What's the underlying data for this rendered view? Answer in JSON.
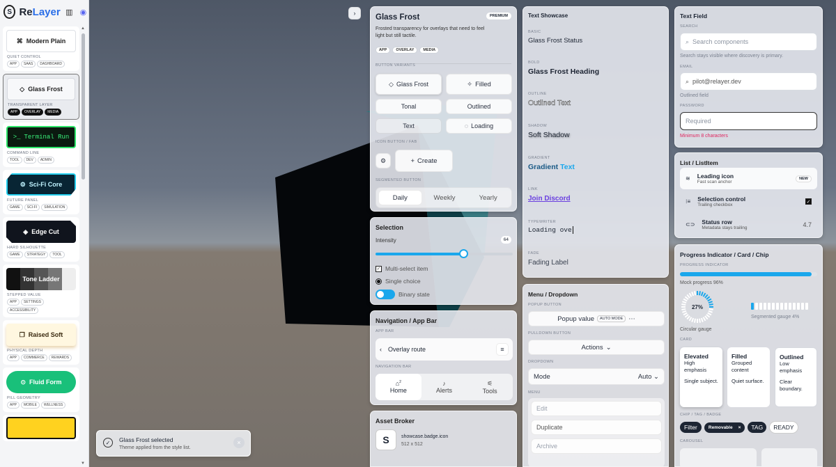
{
  "brand": {
    "name_a": "Re",
    "name_b": "Layer"
  },
  "styles": [
    {
      "name": "Modern Plain",
      "icon": "⌘",
      "caption": "QUIET CONTROL",
      "tags": [
        "APP",
        "SAAS",
        "DASHBOARD"
      ]
    },
    {
      "name": "Glass Frost",
      "icon": "◇",
      "caption": "TRANSPARENT LAYER",
      "tags": [
        "APP",
        "OVERLAY",
        "MEDIA"
      ]
    },
    {
      "name": "Terminal Run",
      "icon": ">_",
      "caption": "COMMAND LINE",
      "tags": [
        "TOOL",
        "DEV",
        "ADMIN"
      ]
    },
    {
      "name": "Sci-Fi Core",
      "icon": "⚙",
      "caption": "FUTURE PANEL",
      "tags": [
        "GAME",
        "SCI-FI",
        "SIMULATION"
      ]
    },
    {
      "name": "Edge Cut",
      "icon": "◈",
      "caption": "HARD SILHOUETTE",
      "tags": [
        "GAME",
        "STRATEGY",
        "TOOL"
      ]
    },
    {
      "name": "Tone Ladder",
      "icon": "",
      "caption": "STEPPED VALUE",
      "tags": [
        "APP",
        "SETTINGS",
        "ACCESSIBILITY"
      ]
    },
    {
      "name": "Raised Soft",
      "icon": "❒",
      "caption": "PHYSICAL DEPTH",
      "tags": [
        "APP",
        "COMMERCE",
        "REWARDS"
      ]
    },
    {
      "name": "Fluid Form",
      "icon": "⊙",
      "caption": "PILL GEOMETRY",
      "tags": [
        "APP",
        "MOBILE",
        "WELLNESS"
      ]
    }
  ],
  "glass": {
    "title": "Glass Frost",
    "badge": "PREMIUM",
    "desc": "Frosted transparency for overlays that need to feel light but still tactile.",
    "tags": [
      "APP",
      "OVERLAY",
      "MEDIA"
    ],
    "variants_cap": "BUTTON VARIANTS",
    "btn_glass": "Glass Frost",
    "btn_filled": "Filled",
    "btn_tonal": "Tonal",
    "btn_outlined": "Outlined",
    "btn_text": "Text",
    "btn_loading": "Loading",
    "fab_cap": "ICON BUTTON / FAB",
    "fab_label": "Create",
    "seg_cap": "SEGMENTED BUTTON",
    "seg": [
      "Daily",
      "Weekly",
      "Yearly"
    ]
  },
  "selection": {
    "title": "Selection",
    "intensity_label": "Intensity",
    "intensity_value": "64",
    "intensity": 64,
    "multi": "Multi-select item",
    "single": "Single choice",
    "binary": "Binary state"
  },
  "nav": {
    "title": "Navigation / App Bar",
    "appbar_cap": "APP BAR",
    "route": "Overlay route",
    "nav_cap": "NAVIGATION BAR",
    "home": "Home",
    "home_badge": "2",
    "alerts": "Alerts",
    "tools": "Tools"
  },
  "asset": {
    "title": "Asset Broker",
    "name": "showcase.badge.icon",
    "size": "512 x 512"
  },
  "text_showcase": {
    "title": "Text Showcase",
    "items": [
      {
        "cap": "BASIC",
        "text": "Glass Frost Status"
      },
      {
        "cap": "BOLD",
        "text": "Glass Frost Heading"
      },
      {
        "cap": "OUTLINE",
        "text": "Outlined Text"
      },
      {
        "cap": "SHADOW",
        "text": "Soft Shadow"
      },
      {
        "cap": "GRADIENT",
        "text_a": "Gradient ",
        "text_b": "Text"
      },
      {
        "cap": "LINK",
        "text": "Join Discord"
      },
      {
        "cap": "TYPEWRITER",
        "text": "Loading ove"
      },
      {
        "cap": "FADE",
        "text": "Fading Label"
      }
    ]
  },
  "menu": {
    "title": "Menu / Dropdown",
    "popup_cap": "POPUP BUTTON",
    "popup_value": "Popup value",
    "popup_mode": "AUTO MODE",
    "pulldown_cap": "PULLDOWN BUTTON",
    "actions": "Actions",
    "dropdown_cap": "DROPDOWN",
    "mode_label": "Mode",
    "mode_value": "Auto",
    "menu_cap": "MENU",
    "menu_items": [
      "Edit",
      "Duplicate",
      "Archive"
    ]
  },
  "textfield": {
    "title": "Text Field",
    "search_cap": "SEARCH",
    "search_ph": "Search components",
    "search_help": "Search stays visible where discovery is primary.",
    "email_cap": "EMAIL",
    "email_value": "pilot@relayer.dev",
    "email_help": "Outlined field",
    "pw_cap": "PASSWORD",
    "pw_ph": "Required",
    "pw_err": "Minimum 8 characters"
  },
  "list": {
    "title": "List / ListItem",
    "items": [
      {
        "title": "Leading icon",
        "sub": "Fast scan anchor",
        "trail": "NEW"
      },
      {
        "title": "Selection control",
        "sub": "Trailing checkbox",
        "trail": "✓"
      },
      {
        "title": "Status row",
        "sub": "Metadata stays trailing",
        "trail": "4.7"
      }
    ]
  },
  "progress": {
    "title": "Progress Indicator / Card / Chip",
    "ind_cap": "PROGRESS INDICATOR",
    "mock": "Mock progress 96%",
    "mock_value": 96,
    "circ_value": "27%",
    "circ_pct": 27,
    "circ_label": "Circular gauge",
    "seg_label": "Segmented gauge 4%",
    "seg_pct": 4,
    "card_cap": "CARD",
    "cards": [
      {
        "t": "Elevated",
        "a": "High emphasis",
        "b": "Single subject."
      },
      {
        "t": "Filled",
        "a": "Grouped content",
        "b": "Quiet surface."
      },
      {
        "t": "Outlined",
        "a": "Low emphasis",
        "b": "Clear boundary."
      }
    ],
    "chip_cap": "CHIP / TAG / BADGE",
    "chips": [
      "Filter",
      "Removable",
      "TAG",
      "READY"
    ],
    "carousel_cap": "CAROUSEL"
  },
  "toast": {
    "title": "Glass Frost selected",
    "sub": "Theme applied from the style list."
  },
  "colors": {
    "accent": "#1aa7ec",
    "error": "#e0245e"
  }
}
